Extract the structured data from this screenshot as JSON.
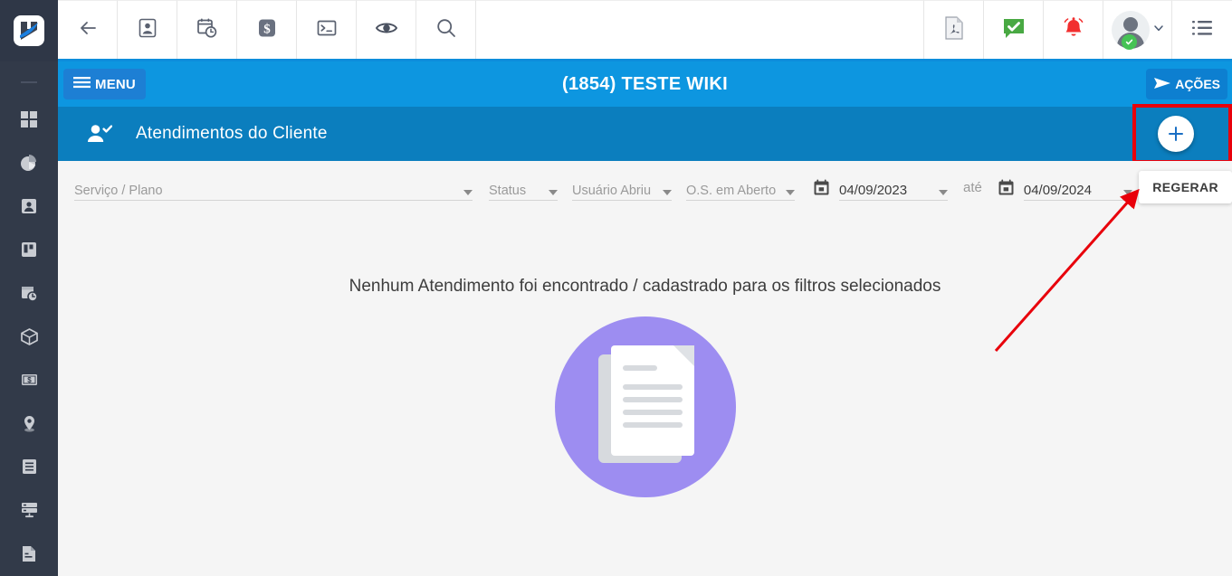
{
  "colors": {
    "sidebar_bg": "#323a49",
    "header_blue": "#0d96e0",
    "subheader_blue": "#0b7ebe",
    "menu_btn_blue": "#1d7fd4",
    "annotation_red": "#e8000b",
    "illustration_purple": "#9d8df1",
    "accent_green": "#46c355",
    "alert_red": "#f22f2f",
    "content_bg": "#f5f5f5"
  },
  "sidebar": {
    "logo": "hiper-logo",
    "items": [
      {
        "icon": "grid-dashboard-icon",
        "name": "sidebar-item-dashboard"
      },
      {
        "icon": "pie-chart-icon",
        "name": "sidebar-item-reports"
      },
      {
        "icon": "contact-card-icon",
        "name": "sidebar-item-contacts"
      },
      {
        "icon": "kanban-board-icon",
        "name": "sidebar-item-board"
      },
      {
        "icon": "calendar-clock-icon",
        "name": "sidebar-item-schedule"
      },
      {
        "icon": "box-package-icon",
        "name": "sidebar-item-products"
      },
      {
        "icon": "money-bill-icon",
        "name": "sidebar-item-finance"
      },
      {
        "icon": "map-pin-icon",
        "name": "sidebar-item-location"
      },
      {
        "icon": "list-lines-icon",
        "name": "sidebar-item-list"
      },
      {
        "icon": "server-rack-icon",
        "name": "sidebar-item-network"
      },
      {
        "icon": "document-icon",
        "name": "sidebar-item-documents"
      }
    ]
  },
  "toolbar": {
    "items": [
      {
        "icon": "back-arrow-icon",
        "name": "toolbar-back-button"
      },
      {
        "icon": "contact-card-icon",
        "name": "toolbar-client-button"
      },
      {
        "icon": "calendar-clock-icon",
        "name": "toolbar-schedule-button"
      },
      {
        "icon": "money-dollar-icon",
        "name": "toolbar-finance-button"
      },
      {
        "icon": "terminal-console-icon",
        "name": "toolbar-console-button"
      },
      {
        "icon": "eye-icon",
        "name": "toolbar-view-button"
      },
      {
        "icon": "search-icon",
        "name": "toolbar-search-button"
      }
    ],
    "right_items": [
      {
        "icon": "pdf-file-icon",
        "name": "toolbar-pdf-button"
      },
      {
        "icon": "green-check-icon",
        "name": "toolbar-tasks-button"
      },
      {
        "icon": "red-bell-icon",
        "name": "toolbar-notifications-button"
      }
    ],
    "avatar": {
      "icon": "user-avatar",
      "status": "online",
      "chevron": "chevron-down-icon"
    },
    "menu_list": {
      "icon": "list-menu-icon",
      "name": "toolbar-menu-button"
    }
  },
  "page_header": {
    "menu_label": "MENU",
    "menu_icon": "hamburger-icon",
    "title": "(1854) TESTE WIKI",
    "actions_label": "AÇÕES",
    "actions_icon": "send-arrow-icon"
  },
  "sub_header": {
    "icon": "user-check-icon",
    "title": "Atendimentos do Cliente",
    "add_button": "+"
  },
  "filters": {
    "servico_plano": {
      "label": "Serviço / Plano",
      "value": ""
    },
    "status": {
      "label": "Status",
      "value": ""
    },
    "usuario_abriu": {
      "label": "Usuário Abriu",
      "value": ""
    },
    "os_em_aberto": {
      "label": "O.S. em Aberto",
      "value": ""
    },
    "date_from": {
      "value": "04/09/2023",
      "icon": "calendar-icon"
    },
    "between_label": "até",
    "date_to": {
      "value": "04/09/2024",
      "icon": "calendar-icon"
    },
    "regerar_label": "REGERAR"
  },
  "empty_state": {
    "message": "Nenhum Atendimento foi encontrado / cadastrado para os filtros selecionados",
    "illustration": "documents-illustration"
  },
  "annotations": {
    "arrow": "red-arrow-pointing-to-regerar",
    "highlight": "red-box-around-add-button"
  }
}
